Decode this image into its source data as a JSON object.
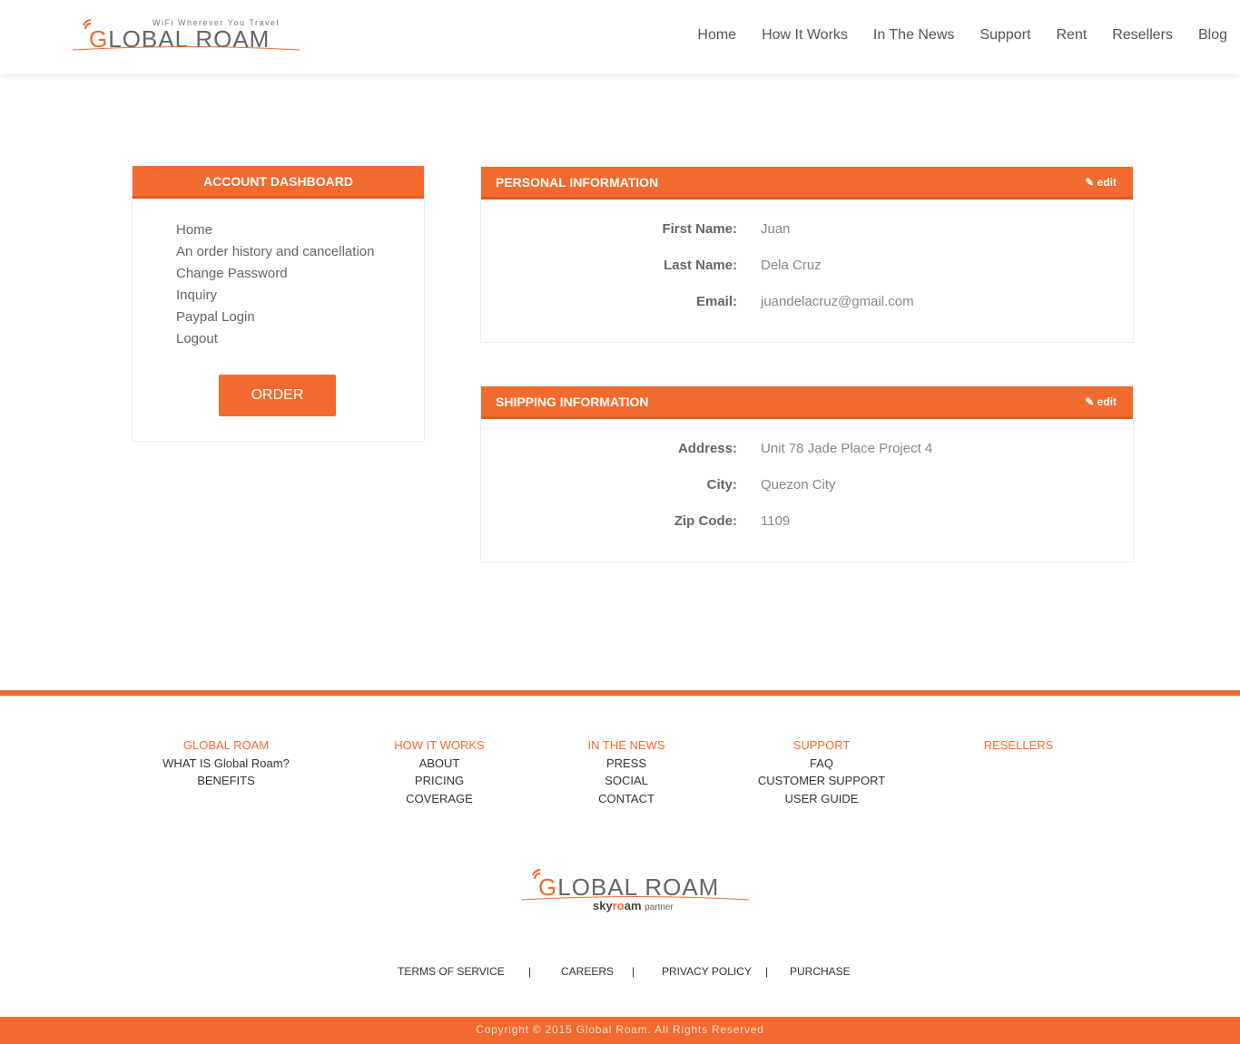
{
  "header": {
    "logo": {
      "tagline": "WiFi Wherever You Travel",
      "name_first": "G",
      "name_rest": "LOBAL ROAM"
    },
    "nav": [
      "Home",
      "How It Works",
      "In The News",
      "Support",
      "Rent",
      "Resellers",
      "Blog"
    ]
  },
  "dashboard": {
    "title": "ACCOUNT DASHBOARD",
    "links": [
      "Home",
      "An order history and cancellation",
      "Change Password",
      "Inquiry",
      "Paypal Login",
      "Logout"
    ],
    "order_label": "ORDER"
  },
  "personal": {
    "title": "PERSONAL INFORMATION",
    "edit_label": "edit",
    "fields": [
      {
        "label": "First Name:",
        "value": "Juan"
      },
      {
        "label": "Last Name:",
        "value": "Dela Cruz"
      },
      {
        "label": "Email:",
        "value": "juandelacruz@gmail.com"
      }
    ]
  },
  "shipping": {
    "title": "SHIPPING INFORMATION",
    "edit_label": "edit",
    "fields": [
      {
        "label": "Address:",
        "value": "Unit 78  Jade Place Project 4"
      },
      {
        "label": "City:",
        "value": "Quezon City"
      },
      {
        "label": "Zip Code:",
        "value": "1109"
      }
    ]
  },
  "footer": {
    "columns": [
      {
        "heading": "GLOBAL ROAM",
        "items": [
          "WHAT IS Global Roam?",
          "BENEFITS"
        ]
      },
      {
        "heading": "HOW IT WORKS",
        "items": [
          "ABOUT",
          "PRICING",
          "COVERAGE"
        ]
      },
      {
        "heading": "IN THE NEWS",
        "items": [
          "PRESS",
          "SOCIAL",
          "CONTACT"
        ]
      },
      {
        "heading": "SUPPORT",
        "items": [
          "FAQ",
          "CUSTOMER SUPPORT",
          "USER GUIDE"
        ]
      },
      {
        "heading": "RESELLERS",
        "items": []
      }
    ],
    "logo": {
      "name_first": "G",
      "name_rest": "LOBAL ROAM",
      "partner_sky": "sky",
      "partner_r": "r",
      "partner_o": "o",
      "partner_am": "am",
      "partner_word": "partner"
    },
    "legal": [
      "TERMS OF SERVICE",
      "|",
      "CAREERS",
      "|",
      "PRIVACY POLICY",
      "|",
      "PURCHASE"
    ],
    "copyright": "Copyright © 2015 Global Roam. All Rights Reserved"
  },
  "colors": {
    "accent": "#f26a2e"
  }
}
